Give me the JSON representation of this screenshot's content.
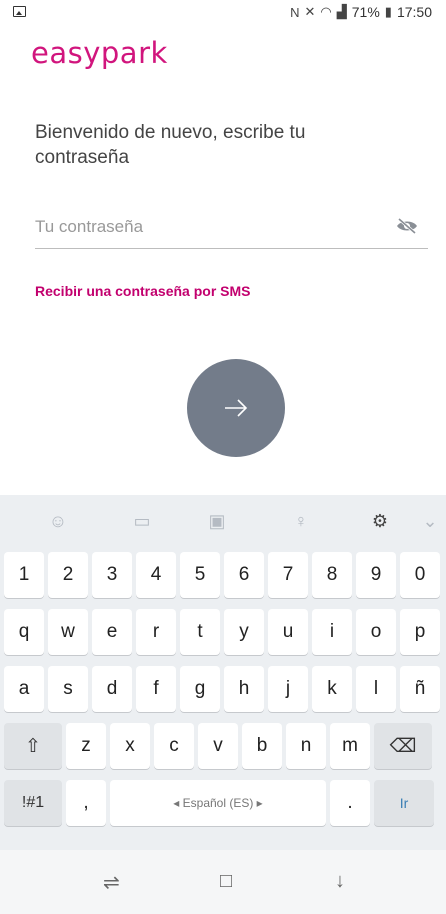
{
  "status_bar": {
    "battery": "71%",
    "time": "17:50"
  },
  "brand": {
    "logo_text": "easypark",
    "color": "#d1157d"
  },
  "login": {
    "welcome_text": "Bienvenido de nuevo, escribe tu contraseña",
    "password_placeholder": "Tu contraseña",
    "sms_link": "Recibir una contraseña por SMS",
    "submit_arrow": "→"
  },
  "keyboard": {
    "number_row": [
      "1",
      "2",
      "3",
      "4",
      "5",
      "6",
      "7",
      "8",
      "9",
      "0"
    ],
    "row1": [
      "q",
      "w",
      "e",
      "r",
      "t",
      "y",
      "u",
      "i",
      "o",
      "p"
    ],
    "row2": [
      "a",
      "s",
      "d",
      "f",
      "g",
      "h",
      "j",
      "k",
      "l",
      "ñ"
    ],
    "row3": [
      "z",
      "x",
      "c",
      "v",
      "b",
      "n",
      "m"
    ],
    "shift": "⇧",
    "backspace": "⌫",
    "symbols": "!#1",
    "comma": ",",
    "space_label": "◂ Español (ES) ▸",
    "period": ".",
    "enter": "Ir"
  }
}
